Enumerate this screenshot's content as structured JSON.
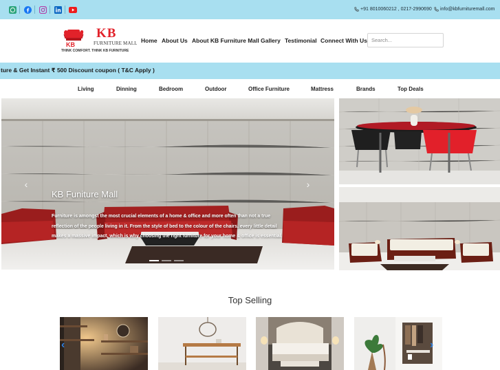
{
  "topbar": {
    "social_icons": [
      "whatsapp-icon",
      "facebook-icon",
      "instagram-icon",
      "linkedin-icon",
      "youtube-icon"
    ],
    "phone": "+91 8010060212 , 0217-2990690",
    "email": "info@kbfurnituremall.com",
    "background": "#a8dff0"
  },
  "brand": {
    "logo_main": "KB",
    "logo_small": "KB",
    "logo_subtitle": "FURNITURE MALL",
    "tagline": "THINK COMFORT. THINK KB FURNITURE",
    "accent": "#e2222a"
  },
  "nav": {
    "items": [
      "Home",
      "About Us",
      "About KB Furniture Mall",
      "Gallery",
      "Testimonial",
      "Connect With Us"
    ]
  },
  "search": {
    "placeholder": "Search..."
  },
  "promo": {
    "text": "ture & Get Instant ₹ 500 Discount coupon ( T&C Apply )"
  },
  "categories": [
    "Living",
    "Dinning",
    "Bedroom",
    "Outdoor",
    "Office Furniture",
    "Mattress",
    "Brands",
    "Top Deals"
  ],
  "slider": {
    "title": "KB Funiture Mall",
    "text": "Furniture is amongst the most crucial elements of a home & office and more often than not a true reflection of the people living in it. From the style of bed to the colour of the chairs, every little detail makes a massive impact, which is why choosing the right furniture for your home & office is essential.",
    "prev_icon": "‹",
    "next_icon": "›"
  },
  "top_selling": {
    "title": "Top Selling",
    "prev_icon": "‹",
    "next_icon": "›"
  }
}
